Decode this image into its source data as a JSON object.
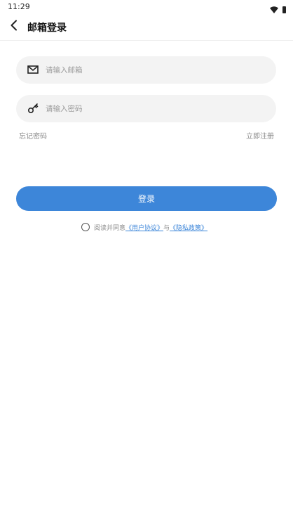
{
  "status_bar": {
    "time": "11:29",
    "icons": [
      "wifi-icon",
      "battery-icon"
    ]
  },
  "header": {
    "title": "邮箱登录",
    "back_icon": "chevron-left-icon"
  },
  "form": {
    "email": {
      "icon": "mail-icon",
      "placeholder": "请输入邮箱",
      "value": ""
    },
    "password": {
      "icon": "key-icon",
      "placeholder": "请输入密码",
      "value": ""
    },
    "forgot_label": "忘记密码",
    "register_label": "立即注册",
    "login_label": "登录"
  },
  "agreement": {
    "checked": false,
    "prefix": "阅读并同意",
    "user_agreement": "《用户协议》",
    "conjunction": "与",
    "privacy_policy": "《隐私政策》"
  },
  "colors": {
    "accent": "#3d86d9",
    "field_bg": "#f3f3f3",
    "muted_text": "#8a8a8a"
  }
}
